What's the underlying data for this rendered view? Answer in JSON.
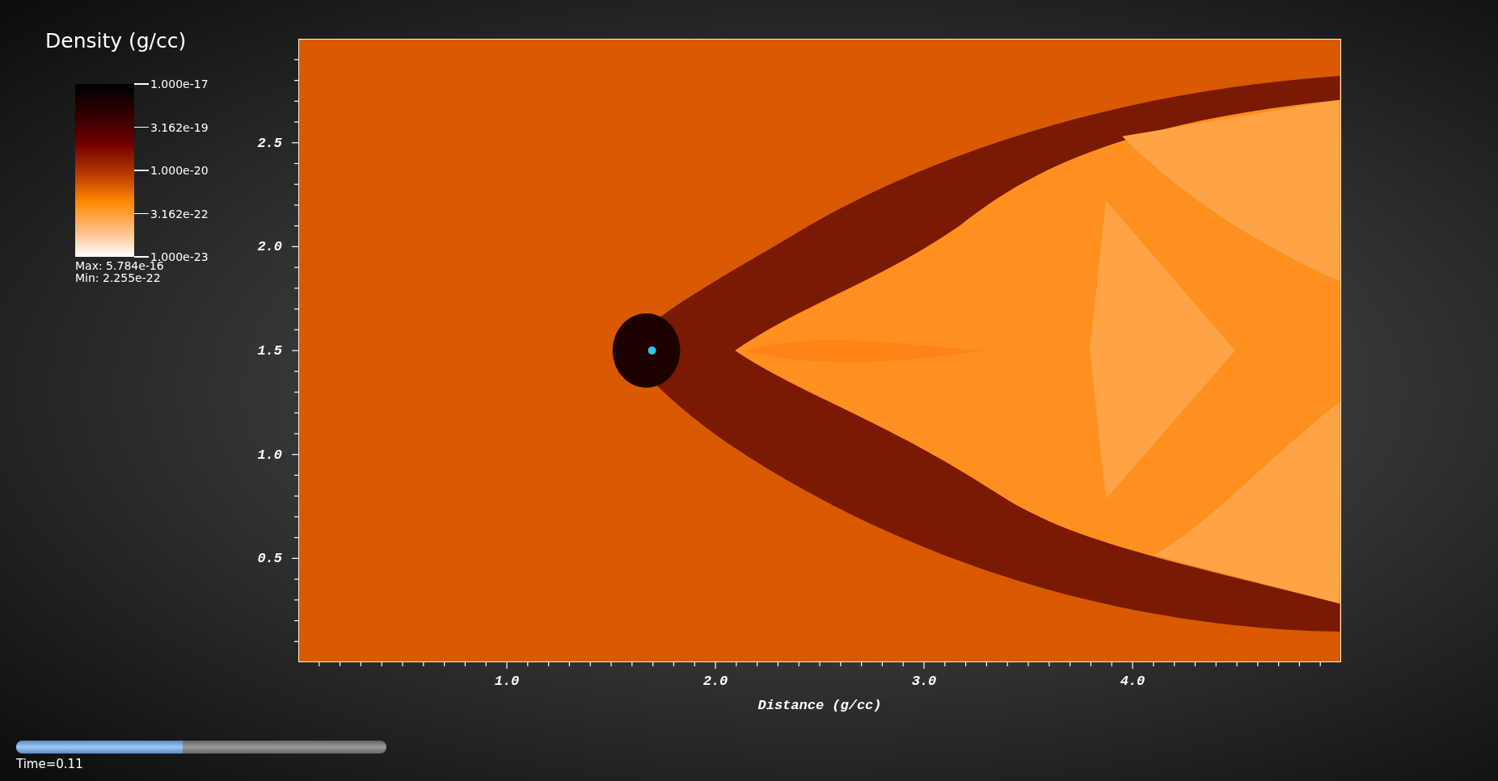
{
  "legend": {
    "title": "Density (g/cc)",
    "ticks": [
      "1.000e-17",
      "3.162e-19",
      "1.000e-20",
      "3.162e-22",
      "1.000e-23"
    ],
    "max": "Max:  5.784e-16",
    "min": "Min:  2.255e-22"
  },
  "plot": {
    "y_ticks": [
      "2.5",
      "2.0",
      "1.5",
      "1.0",
      "0.5"
    ],
    "x_ticks": [
      "1.0",
      "2.0",
      "3.0",
      "4.0"
    ],
    "x_label": "Distance (g/cc)"
  },
  "time_slider": {
    "level": 0.45,
    "label": "Time=0.11"
  }
}
